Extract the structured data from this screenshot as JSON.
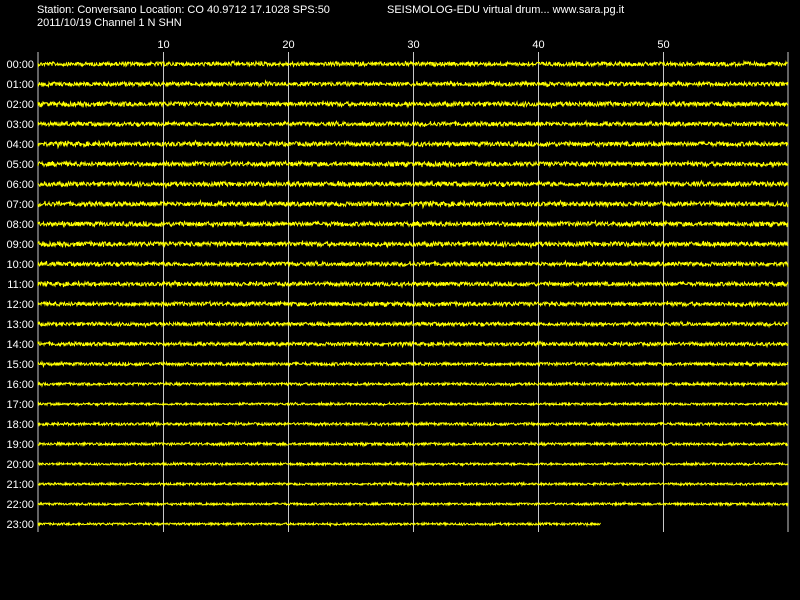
{
  "header": {
    "station_line": "Station: Conversano Location: CO 40.9712 17.1028 SPS:50",
    "date_line": "2011/10/19  Channel 1 N SHN",
    "app_line": "SEISMOLOG-EDU virtual drum... www.sara.pg.it"
  },
  "colors": {
    "background": "#000000",
    "trace": "#ffff00",
    "grid": "#c8c8c8",
    "text": "#ffffff"
  },
  "chart_data": {
    "type": "line",
    "x_unit": "minutes",
    "xlim": [
      0,
      60
    ],
    "x_ticks": [
      10,
      20,
      30,
      40,
      50
    ],
    "grid": true,
    "rows": [
      {
        "label": "00:00",
        "end_minute": 60,
        "amplitude": 0.9
      },
      {
        "label": "01:00",
        "end_minute": 60,
        "amplitude": 0.9
      },
      {
        "label": "02:00",
        "end_minute": 60,
        "amplitude": 1.0
      },
      {
        "label": "03:00",
        "end_minute": 60,
        "amplitude": 0.9
      },
      {
        "label": "04:00",
        "end_minute": 60,
        "amplitude": 1.0
      },
      {
        "label": "05:00",
        "end_minute": 60,
        "amplitude": 1.0
      },
      {
        "label": "06:00",
        "end_minute": 60,
        "amplitude": 1.0
      },
      {
        "label": "07:00",
        "end_minute": 60,
        "amplitude": 1.0
      },
      {
        "label": "08:00",
        "end_minute": 60,
        "amplitude": 1.0
      },
      {
        "label": "09:00",
        "end_minute": 60,
        "amplitude": 1.0
      },
      {
        "label": "10:00",
        "end_minute": 60,
        "amplitude": 0.9
      },
      {
        "label": "11:00",
        "end_minute": 60,
        "amplitude": 0.9
      },
      {
        "label": "12:00",
        "end_minute": 60,
        "amplitude": 0.9
      },
      {
        "label": "13:00",
        "end_minute": 60,
        "amplitude": 0.8
      },
      {
        "label": "14:00",
        "end_minute": 60,
        "amplitude": 0.8
      },
      {
        "label": "15:00",
        "end_minute": 60,
        "amplitude": 0.7
      },
      {
        "label": "16:00",
        "end_minute": 60,
        "amplitude": 0.6
      },
      {
        "label": "17:00",
        "end_minute": 60,
        "amplitude": 0.5
      },
      {
        "label": "18:00",
        "end_minute": 60,
        "amplitude": 0.6
      },
      {
        "label": "19:00",
        "end_minute": 60,
        "amplitude": 0.6
      },
      {
        "label": "20:00",
        "end_minute": 60,
        "amplitude": 0.5
      },
      {
        "label": "21:00",
        "end_minute": 60,
        "amplitude": 0.5
      },
      {
        "label": "22:00",
        "end_minute": 60,
        "amplitude": 0.5
      },
      {
        "label": "23:00",
        "end_minute": 45,
        "amplitude": 0.5
      }
    ]
  }
}
